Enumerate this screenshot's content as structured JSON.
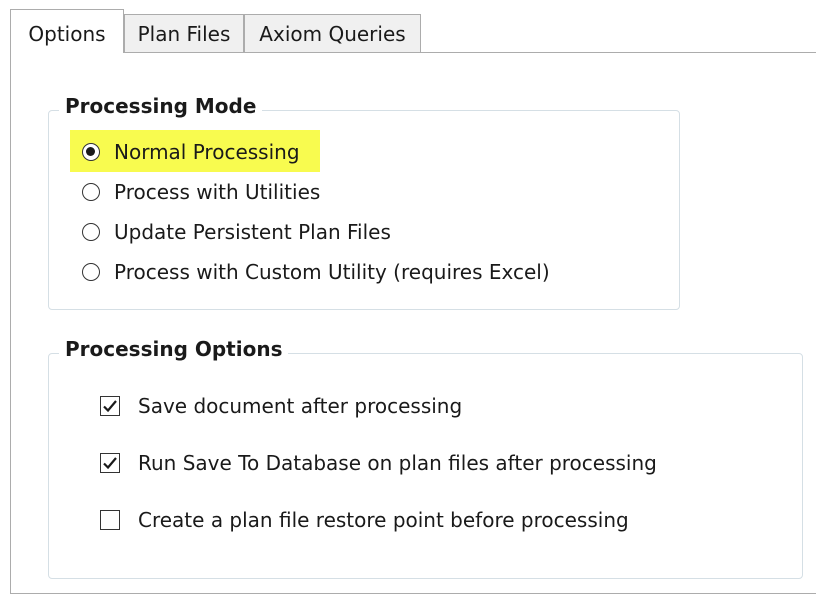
{
  "tabs": [
    {
      "label": "Options",
      "active": true
    },
    {
      "label": "Plan Files",
      "active": false
    },
    {
      "label": "Axiom Queries",
      "active": false
    }
  ],
  "processing_mode": {
    "title": "Processing Mode",
    "options": [
      {
        "label": "Normal Processing",
        "selected": true
      },
      {
        "label": "Process with Utilities",
        "selected": false
      },
      {
        "label": "Update Persistent Plan Files",
        "selected": false
      },
      {
        "label": "Process with Custom Utility (requires Excel)",
        "selected": false
      }
    ]
  },
  "processing_options": {
    "title": "Processing Options",
    "options": [
      {
        "label": "Save document after processing",
        "checked": true
      },
      {
        "label": "Run Save To Database on plan files after processing",
        "checked": true
      },
      {
        "label": "Create a plan file restore point before processing",
        "checked": false
      }
    ]
  },
  "colors": {
    "highlight": "#f8fb4f",
    "group_border": "#d5dfe5",
    "tab_border": "#acacac"
  }
}
